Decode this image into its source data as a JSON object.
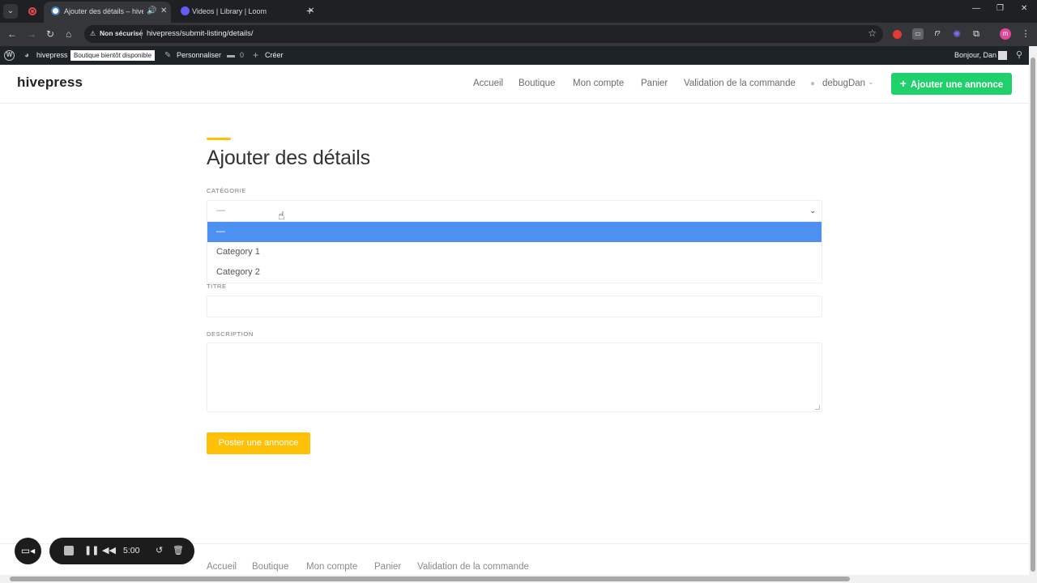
{
  "browser": {
    "tabs": [
      {
        "title": "Ajouter des détails – hivep",
        "active": true
      },
      {
        "title": "Videos | Library | Loom",
        "active": false
      }
    ],
    "security_label": "Non sécurisé",
    "url": "hivepress/submit-listing/details/"
  },
  "admin_bar": {
    "site_name": "hivepress",
    "shop_badge": "Boutique bientôt disponible",
    "customize": "Personnaliser",
    "comments_count": "0",
    "create": "Créer",
    "greeting": "Bonjour, Dan"
  },
  "header": {
    "logo": "hivepress",
    "nav": [
      "Accueil",
      "Boutique",
      "Mon compte",
      "Panier",
      "Validation de la commande"
    ],
    "user": "debugDan",
    "add_listing": "Ajouter une annonce"
  },
  "form": {
    "title": "Ajouter des détails",
    "category_label": "CATÉGORIE",
    "category_value": "—",
    "options": [
      "—",
      "Category 1",
      "Category 2"
    ],
    "title_label": "TITRE",
    "description_label": "DESCRIPTION",
    "submit": "Poster une annonce"
  },
  "footer": {
    "nav": [
      "Accueil",
      "Boutique",
      "Mon compte",
      "Panier",
      "Validation de la commande"
    ]
  },
  "recorder": {
    "time": "5:00"
  },
  "colors": {
    "accent_yellow": "#ffc107",
    "add_button_green": "#1fd16b",
    "option_highlight": "#4c91f2"
  }
}
